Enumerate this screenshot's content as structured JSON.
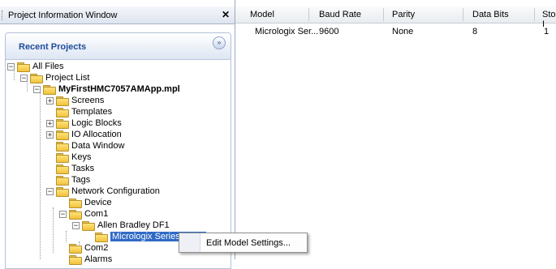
{
  "window": {
    "title": "Project Information Window",
    "close_glyph": "✕"
  },
  "panel": {
    "title": "Recent Projects",
    "collapse_glyph": "»"
  },
  "tree": {
    "all_files": "All Files",
    "project_list": "Project List",
    "project": "MyFirstHMC7057AMApp.mpl",
    "screens": "Screens",
    "templates": "Templates",
    "logic_blocks": "Logic Blocks",
    "io_allocation": "IO Allocation",
    "data_window": "Data Window",
    "keys": "Keys",
    "tasks": "Tasks",
    "tags": "Tags",
    "network_configuration": "Network Configuration",
    "device": "Device",
    "com1": "Com1",
    "allen_bradley": "Allen Bradley DF1",
    "micrologix": "Micrologix Series PLCs",
    "com2": "Com2",
    "alarms": "Alarms"
  },
  "grid": {
    "columns": [
      "Model",
      "Baud Rate",
      "Parity",
      "Data Bits",
      "Stop I"
    ],
    "row": {
      "model": "Micrologix Ser...",
      "baud_rate": "9600",
      "parity": "None",
      "data_bits": "8",
      "stop_bits": "1"
    }
  },
  "context_menu": {
    "item": "Edit Model Settings..."
  },
  "colors": {
    "selection": "#316ac5",
    "panel_title": "#1f4b99",
    "folder": "#f1c23b"
  }
}
